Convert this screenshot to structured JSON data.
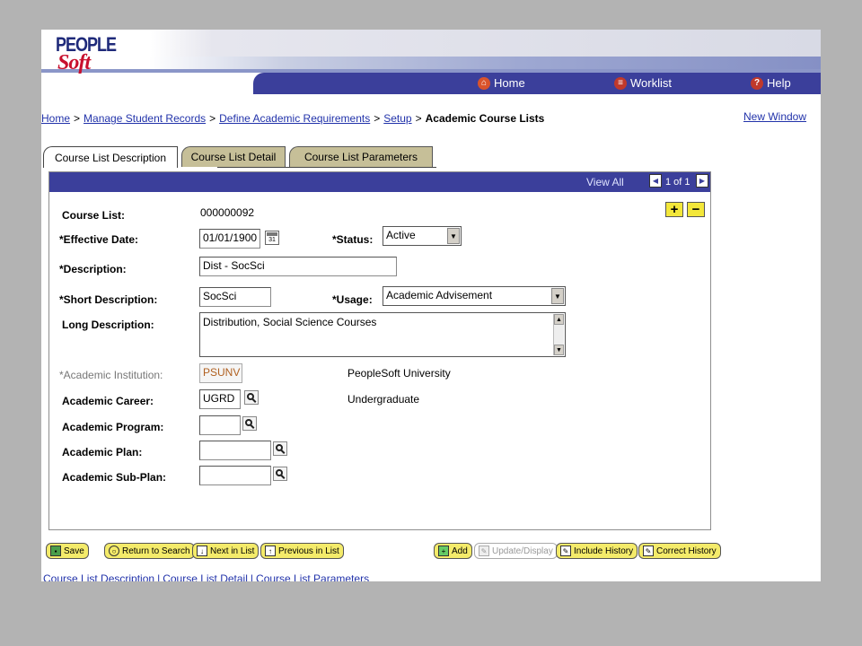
{
  "logo": {
    "line1": "PEOPLE",
    "line2": "Soft"
  },
  "nav": {
    "home": "Home",
    "worklist": "Worklist",
    "help": "Help"
  },
  "breadcrumb": {
    "items": [
      "Home",
      "Manage Student Records",
      "Define Academic Requirements",
      "Setup"
    ],
    "separator": ">",
    "current": "Academic Course Lists"
  },
  "new_window": "New Window",
  "tabs": [
    "Course List Description",
    "Course List Detail",
    "Course List Parameters"
  ],
  "active_tab": "Course List Description",
  "panel": {
    "view_all": "View All",
    "pager_text": "1 of 1"
  },
  "form": {
    "course_list": {
      "label": "Course List:",
      "value": "000000092"
    },
    "effective_date": {
      "label": "*Effective Date:",
      "value": "01/01/1900"
    },
    "status": {
      "label": "*Status:",
      "value": "Active"
    },
    "description": {
      "label": "*Description:",
      "value": "Dist - SocSci"
    },
    "short_description": {
      "label": "*Short Description:",
      "value": "SocSci"
    },
    "usage": {
      "label": "*Usage:",
      "value": "Academic Advisement"
    },
    "long_description": {
      "label": "Long Description:",
      "value": "Distribution, Social Science Courses"
    },
    "academic_institution": {
      "label": "*Academic Institution:",
      "value": "PSUNV",
      "desc": "PeopleSoft University"
    },
    "academic_career": {
      "label": "Academic Career:",
      "value": "UGRD",
      "desc": "Undergraduate"
    },
    "academic_program": {
      "label": "Academic Program:",
      "value": ""
    },
    "academic_plan": {
      "label": "Academic Plan:",
      "value": ""
    },
    "academic_sub_plan": {
      "label": "Academic Sub-Plan:",
      "value": ""
    }
  },
  "buttons": {
    "save": "Save",
    "return_to_search": "Return to Search",
    "next_in_list": "Next in List",
    "previous_in_list": "Previous in List",
    "add": "Add",
    "update_display": "Update/Display",
    "include_history": "Include History",
    "correct_history": "Correct History"
  },
  "footer_links": [
    "Course List Description",
    "Course List Detail",
    "Course List Parameters"
  ],
  "colors": {
    "nav_blue": "#3b3f9b",
    "tab_inactive": "#c6bf98",
    "button_yellow": "#f4eb6a",
    "link_blue": "#2233aa"
  }
}
